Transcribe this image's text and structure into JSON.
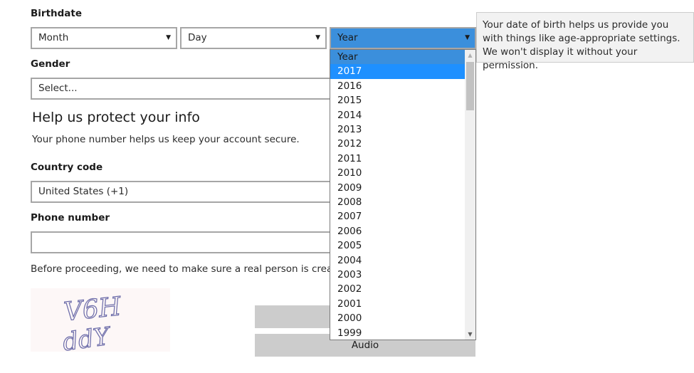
{
  "birthdate": {
    "label": "Birthdate",
    "month_value": "Month",
    "day_value": "Day",
    "year_value": "Year"
  },
  "tooltip": {
    "text": "Your date of birth helps us provide you with things like age-appropriate settings. We won't display it without your permission."
  },
  "gender": {
    "label": "Gender",
    "value": "Select..."
  },
  "protect": {
    "heading": "Help us protect your info",
    "description": "Your phone number helps us keep your account secure."
  },
  "country": {
    "label": "Country code",
    "value": "United States (+1)"
  },
  "phone": {
    "label": "Phone number",
    "value": ""
  },
  "verification": {
    "text": "Before proceeding, we need to make sure a real person is creating",
    "captcha_text": "V6H ddY",
    "audio_label": "Audio"
  },
  "year_dropdown": {
    "options": [
      "Year",
      "2017",
      "2016",
      "2015",
      "2014",
      "2013",
      "2012",
      "2011",
      "2010",
      "2009",
      "2008",
      "2007",
      "2006",
      "2005",
      "2004",
      "2003",
      "2002",
      "2001",
      "2000",
      "1999"
    ],
    "highlighted": "2017"
  },
  "colors": {
    "accent": "#3b8fdc",
    "selected": "#1e90ff",
    "button_gray": "#cccccc"
  }
}
